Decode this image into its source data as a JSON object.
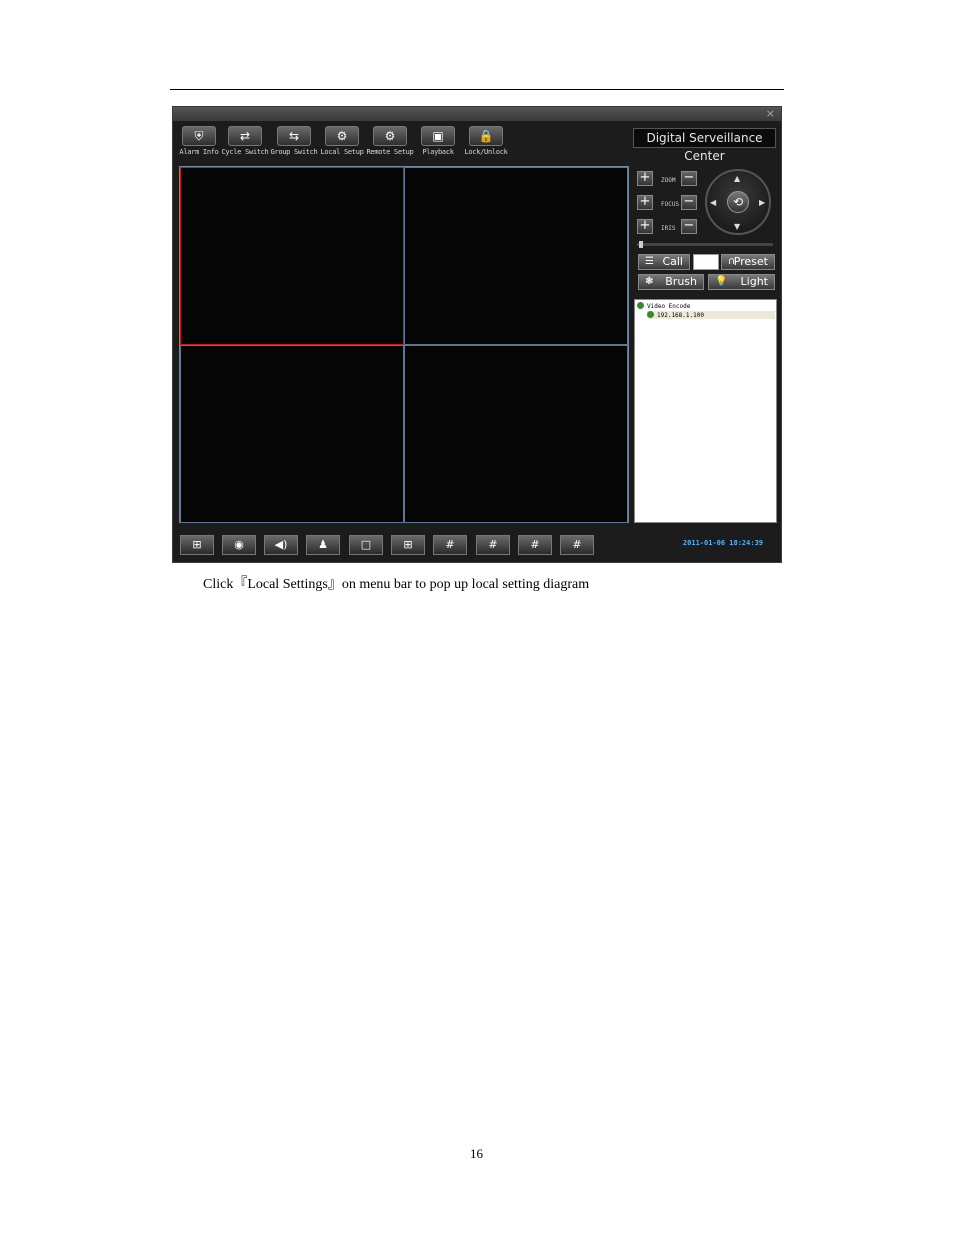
{
  "app": {
    "close_glyph": "×",
    "brand": "Digital Serveillance Center",
    "toolbar": [
      {
        "label": "Alarm Info",
        "icon": "shield-icon",
        "glyph": "⛨"
      },
      {
        "label": "Cycle Switch",
        "icon": "cycle-icon",
        "glyph": "⇄"
      },
      {
        "label": "Group Switch",
        "icon": "group-switch-icon",
        "glyph": "⇆"
      },
      {
        "label": "Local Setup",
        "icon": "gear-icon",
        "glyph": "⚙"
      },
      {
        "label": "Remote Setup",
        "icon": "gear-icon",
        "glyph": "⚙"
      },
      {
        "label": "Playback",
        "icon": "film-icon",
        "glyph": "▣"
      },
      {
        "label": "Lock/Unlock",
        "icon": "lock-icon",
        "glyph": "🔒"
      }
    ],
    "ptz": {
      "zoom": "ZOOM",
      "focus": "FOCUS",
      "iris": "IRIS",
      "plus": "+",
      "minus": "−",
      "up": "▲",
      "down": "▼",
      "left": "◀",
      "right": "▶",
      "center": "⟲",
      "call": "Call",
      "preset": "Preset",
      "brush": "Brush",
      "light": "Light"
    },
    "tree": {
      "root": "Video Encode",
      "child": "192.168.1.100"
    },
    "bottom_buttons": [
      "record-icon",
      "snapshot-icon",
      "speaker-icon",
      "talk-icon",
      "layout-1-icon",
      "layout-4-icon",
      "layout-9-icon",
      "layout-16-icon",
      "layout-25-icon",
      "layout-36-icon"
    ],
    "bottom_glyphs": [
      "⊞",
      "◉",
      "◀)",
      "♟",
      "□",
      "⊞",
      "#",
      "#",
      "#",
      "#"
    ],
    "datetime": "2011-01-06 18:24:39"
  },
  "caption": "Click『Local Settings』on menu bar to pop up local setting diagram",
  "page_number": "16"
}
